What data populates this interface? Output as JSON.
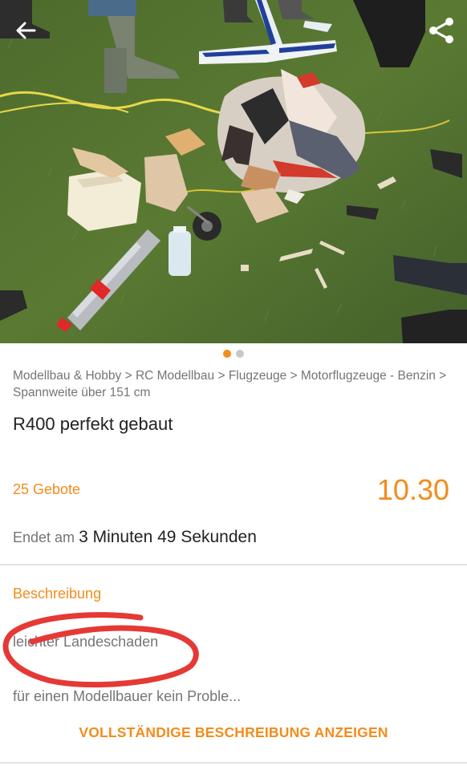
{
  "icons": {
    "back": "arrow-left-icon",
    "share": "share-icon"
  },
  "colors": {
    "accent": "#f28c1c",
    "circle": "#e53935"
  },
  "gallery": {
    "image_count": 2,
    "active_index": 0
  },
  "breadcrumb": "Modellbau & Hobby > RC Modellbau > Flugzeuge > Motorflugzeuge - Benzin > Spannweite über 151 cm",
  "listing": {
    "title": "R400 perfekt gebaut",
    "bids": "25 Gebote",
    "price": "10.30",
    "ends_label": "Endet am",
    "ends_remaining": "3 Minuten 49 Sekunden"
  },
  "description": {
    "heading": "Beschreibung",
    "line1": "leichter Landeschaden",
    "line2": "für einen Modellbauer kein Proble...",
    "show_full": "VOLLSTÄNDIGE BESCHREIBUNG ANZEIGEN"
  }
}
